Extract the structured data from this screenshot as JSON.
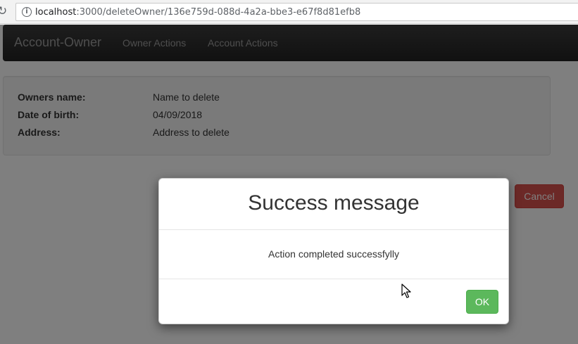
{
  "browser": {
    "url_host": "localhost",
    "url_path": ":3000/deleteOwner/136e759d-088d-4a2a-bbe3-e67f8d81efb8"
  },
  "navbar": {
    "brand": "Account-Owner",
    "links": [
      "Owner Actions",
      "Account Actions"
    ]
  },
  "owner": {
    "fields": [
      {
        "label": "Owners name:",
        "value": "Name to delete"
      },
      {
        "label": "Date of birth:",
        "value": "04/09/2018"
      },
      {
        "label": "Address:",
        "value": "Address to delete"
      }
    ]
  },
  "actions": {
    "cancel_label": "Cancel"
  },
  "modal": {
    "title": "Success message",
    "message": "Action completed successfylly",
    "ok_label": "OK"
  },
  "icons": {
    "reload": "reload-icon",
    "info": "info-icon",
    "cursor": "mouse-cursor-icon"
  },
  "colors": {
    "navbar_bg": "#222222",
    "danger": "#d9534f",
    "success": "#5cb85c"
  }
}
